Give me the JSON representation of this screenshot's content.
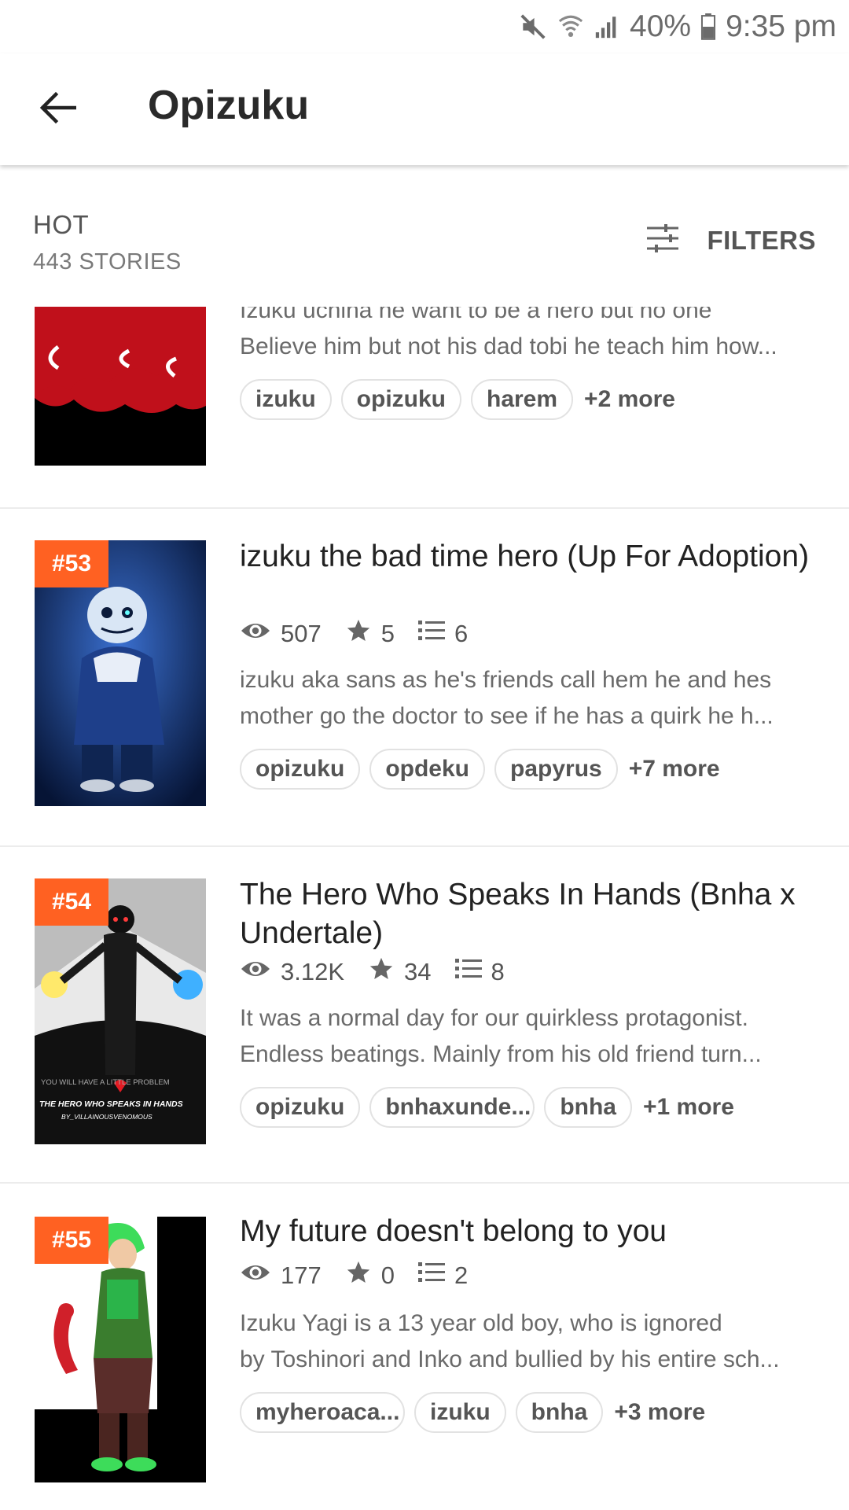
{
  "status_bar": {
    "battery": "40%",
    "time": "9:35 pm"
  },
  "header": {
    "title": "Opizuku"
  },
  "list_header": {
    "sort": "HOT",
    "count": "443 STORIES",
    "filters_label": "FILTERS"
  },
  "stories": [
    {
      "rank": "",
      "title": "",
      "stats": {
        "reads": "",
        "votes": "",
        "parts": ""
      },
      "description": [
        "Izuku uchiha he want to be a hero but no one",
        "Believe him but not his dad tobi he teach him how..."
      ],
      "tags": [
        "izuku",
        "opizuku",
        "harem"
      ],
      "more": "+2 more"
    },
    {
      "rank": "#53",
      "title": "izuku the bad time hero (Up For Adoption)",
      "stats": {
        "reads": "507",
        "votes": "5",
        "parts": "6"
      },
      "description": [
        "izuku aka sans as he's friends call hem he and hes",
        "mother go the doctor to see if he has a quirk he h..."
      ],
      "tags": [
        "opizuku",
        "opdeku",
        "papyrus"
      ],
      "more": "+7 more"
    },
    {
      "rank": "#54",
      "title": "The Hero Who Speaks In Hands (Bnha x Undertale)",
      "stats": {
        "reads": "3.12K",
        "votes": "34",
        "parts": "8"
      },
      "description": [
        "It was a normal day for our quirkless protagonist.",
        "Endless beatings.  Mainly from his old friend turn..."
      ],
      "tags": [
        "opizuku",
        "bnhaxunde...",
        "bnha"
      ],
      "more": "+1 more"
    },
    {
      "rank": "#55",
      "title": "My future doesn't belong to you",
      "stats": {
        "reads": "177",
        "votes": "0",
        "parts": "2"
      },
      "description": [
        "Izuku Yagi is a 13 year old boy, who is ignored",
        "by Toshinori and Inko and bullied by his entire sch..."
      ],
      "tags": [
        "myheroaca...",
        "izuku",
        "bnha"
      ],
      "more": "+3 more"
    }
  ],
  "covers": {
    "c54_line1": "YOU WILL HAVE A LITTLE PROBLEM",
    "c54_line2": "THE HERO WHO SPEAKS IN HANDS",
    "c54_line3": "BY_VILLAINOUSVENOMOUS"
  }
}
